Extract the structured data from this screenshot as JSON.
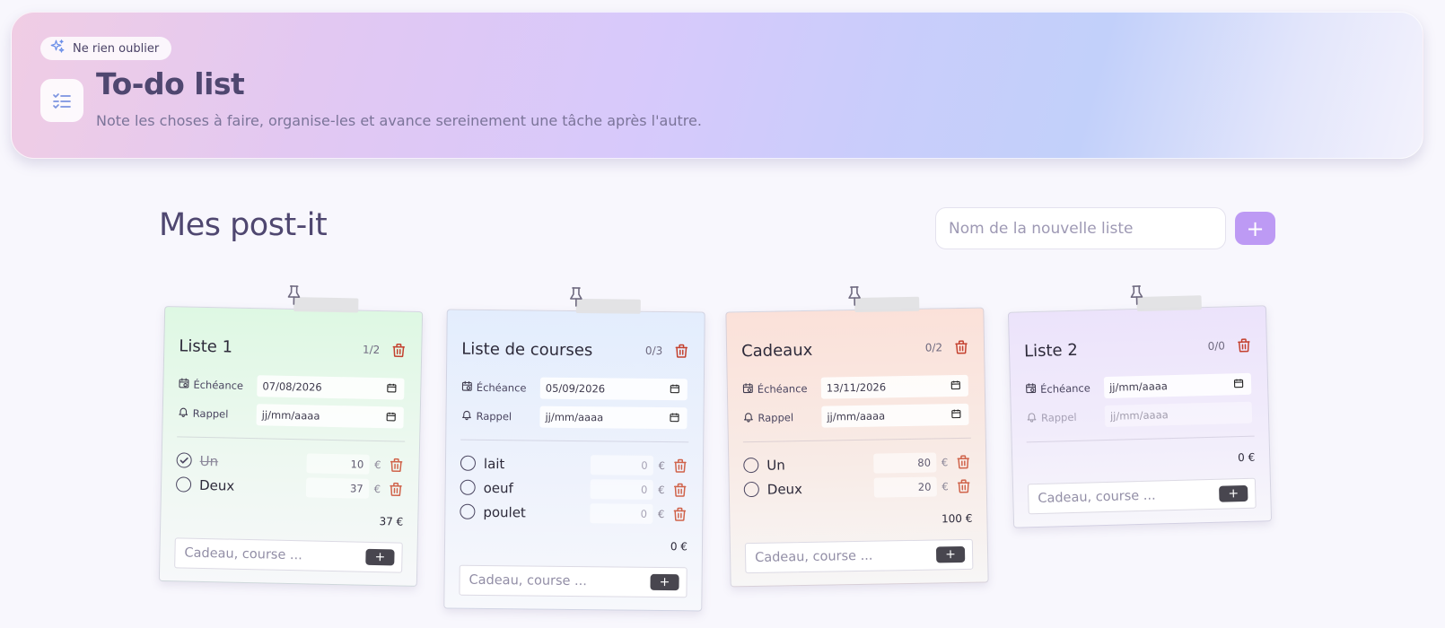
{
  "hero": {
    "pill_label": "Ne rien oublier",
    "title": "To-do list",
    "subtitle": "Note les choses à faire, organise-les et avance sereinement une tâche après l'autre."
  },
  "main": {
    "section_title": "Mes post-it",
    "new_list_placeholder": "Nom de la nouvelle liste",
    "new_list_button": "+"
  },
  "common": {
    "due_label": "Échéance",
    "reminder_label": "Rappel",
    "euro": "€",
    "add_placeholder": "Cadeau, course ...",
    "add_button": "+"
  },
  "lists": [
    {
      "title": "Liste 1",
      "count": "1/2",
      "due": "07/08/2026",
      "reminder": "jj/mm/aaaa",
      "items": [
        {
          "label": "Un",
          "done": true,
          "price": "10"
        },
        {
          "label": "Deux",
          "done": false,
          "price": "37"
        }
      ],
      "total": "37 €"
    },
    {
      "title": "Liste de courses",
      "count": "0/3",
      "due": "05/09/2026",
      "reminder": "jj/mm/aaaa",
      "items": [
        {
          "label": "lait",
          "done": false,
          "price": "0"
        },
        {
          "label": "oeuf",
          "done": false,
          "price": "0"
        },
        {
          "label": "poulet",
          "done": false,
          "price": "0"
        }
      ],
      "total": "0 €"
    },
    {
      "title": "Cadeaux",
      "count": "0/2",
      "due": "13/11/2026",
      "reminder": "jj/mm/aaaa",
      "items": [
        {
          "label": "Un",
          "done": false,
          "price": "80"
        },
        {
          "label": "Deux",
          "done": false,
          "price": "20"
        }
      ],
      "total": "100 €"
    },
    {
      "title": "Liste 2",
      "count": "0/0",
      "due": "jj/mm/aaaa",
      "reminder": "jj/mm/aaaa",
      "items": [],
      "total": "0 €"
    }
  ]
}
